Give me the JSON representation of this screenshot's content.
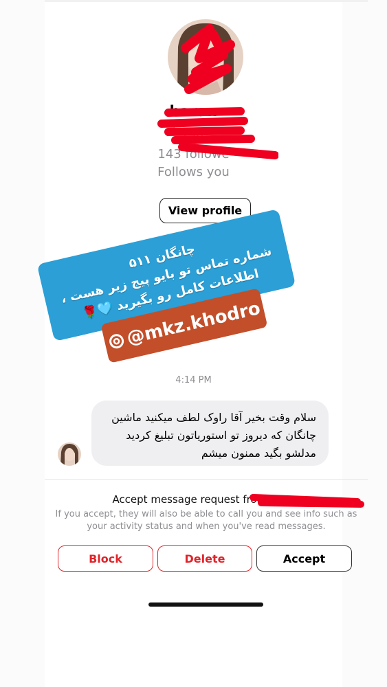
{
  "profile": {
    "name": "baran",
    "username": "ran",
    "followers": "143 followe",
    "follows_you": "Follows you",
    "view_profile_label": "View profile"
  },
  "story": {
    "line1": "شماره تماس تو بایو پیج زیر هست ،",
    "line2": "چانگان ۵۱۱",
    "line3": "اطلاعات کامل رو بگیرید 🩵🌹",
    "handle": "@mkz.khodro",
    "colors": {
      "blue": "#2b9fd6",
      "orange": "#c24f2a"
    }
  },
  "chat": {
    "timestamp": "4:14 PM",
    "message": "سلام وقت بخیر آقا راوک لطف میکنید ماشین چانگان که دیروز تو استوریاتون تبلیغ کردید مدلشو بگید ممنون میشم"
  },
  "request": {
    "title": "Accept message request from baran",
    "description": "If you accept, they will also be able to call you and see info such as your activity status and when you've read messages.",
    "block_label": "Block",
    "delete_label": "Delete",
    "accept_label": "Accept"
  },
  "colors": {
    "danger": "#e0242a",
    "redaction": "#f00020",
    "muted": "#8e8e93"
  }
}
